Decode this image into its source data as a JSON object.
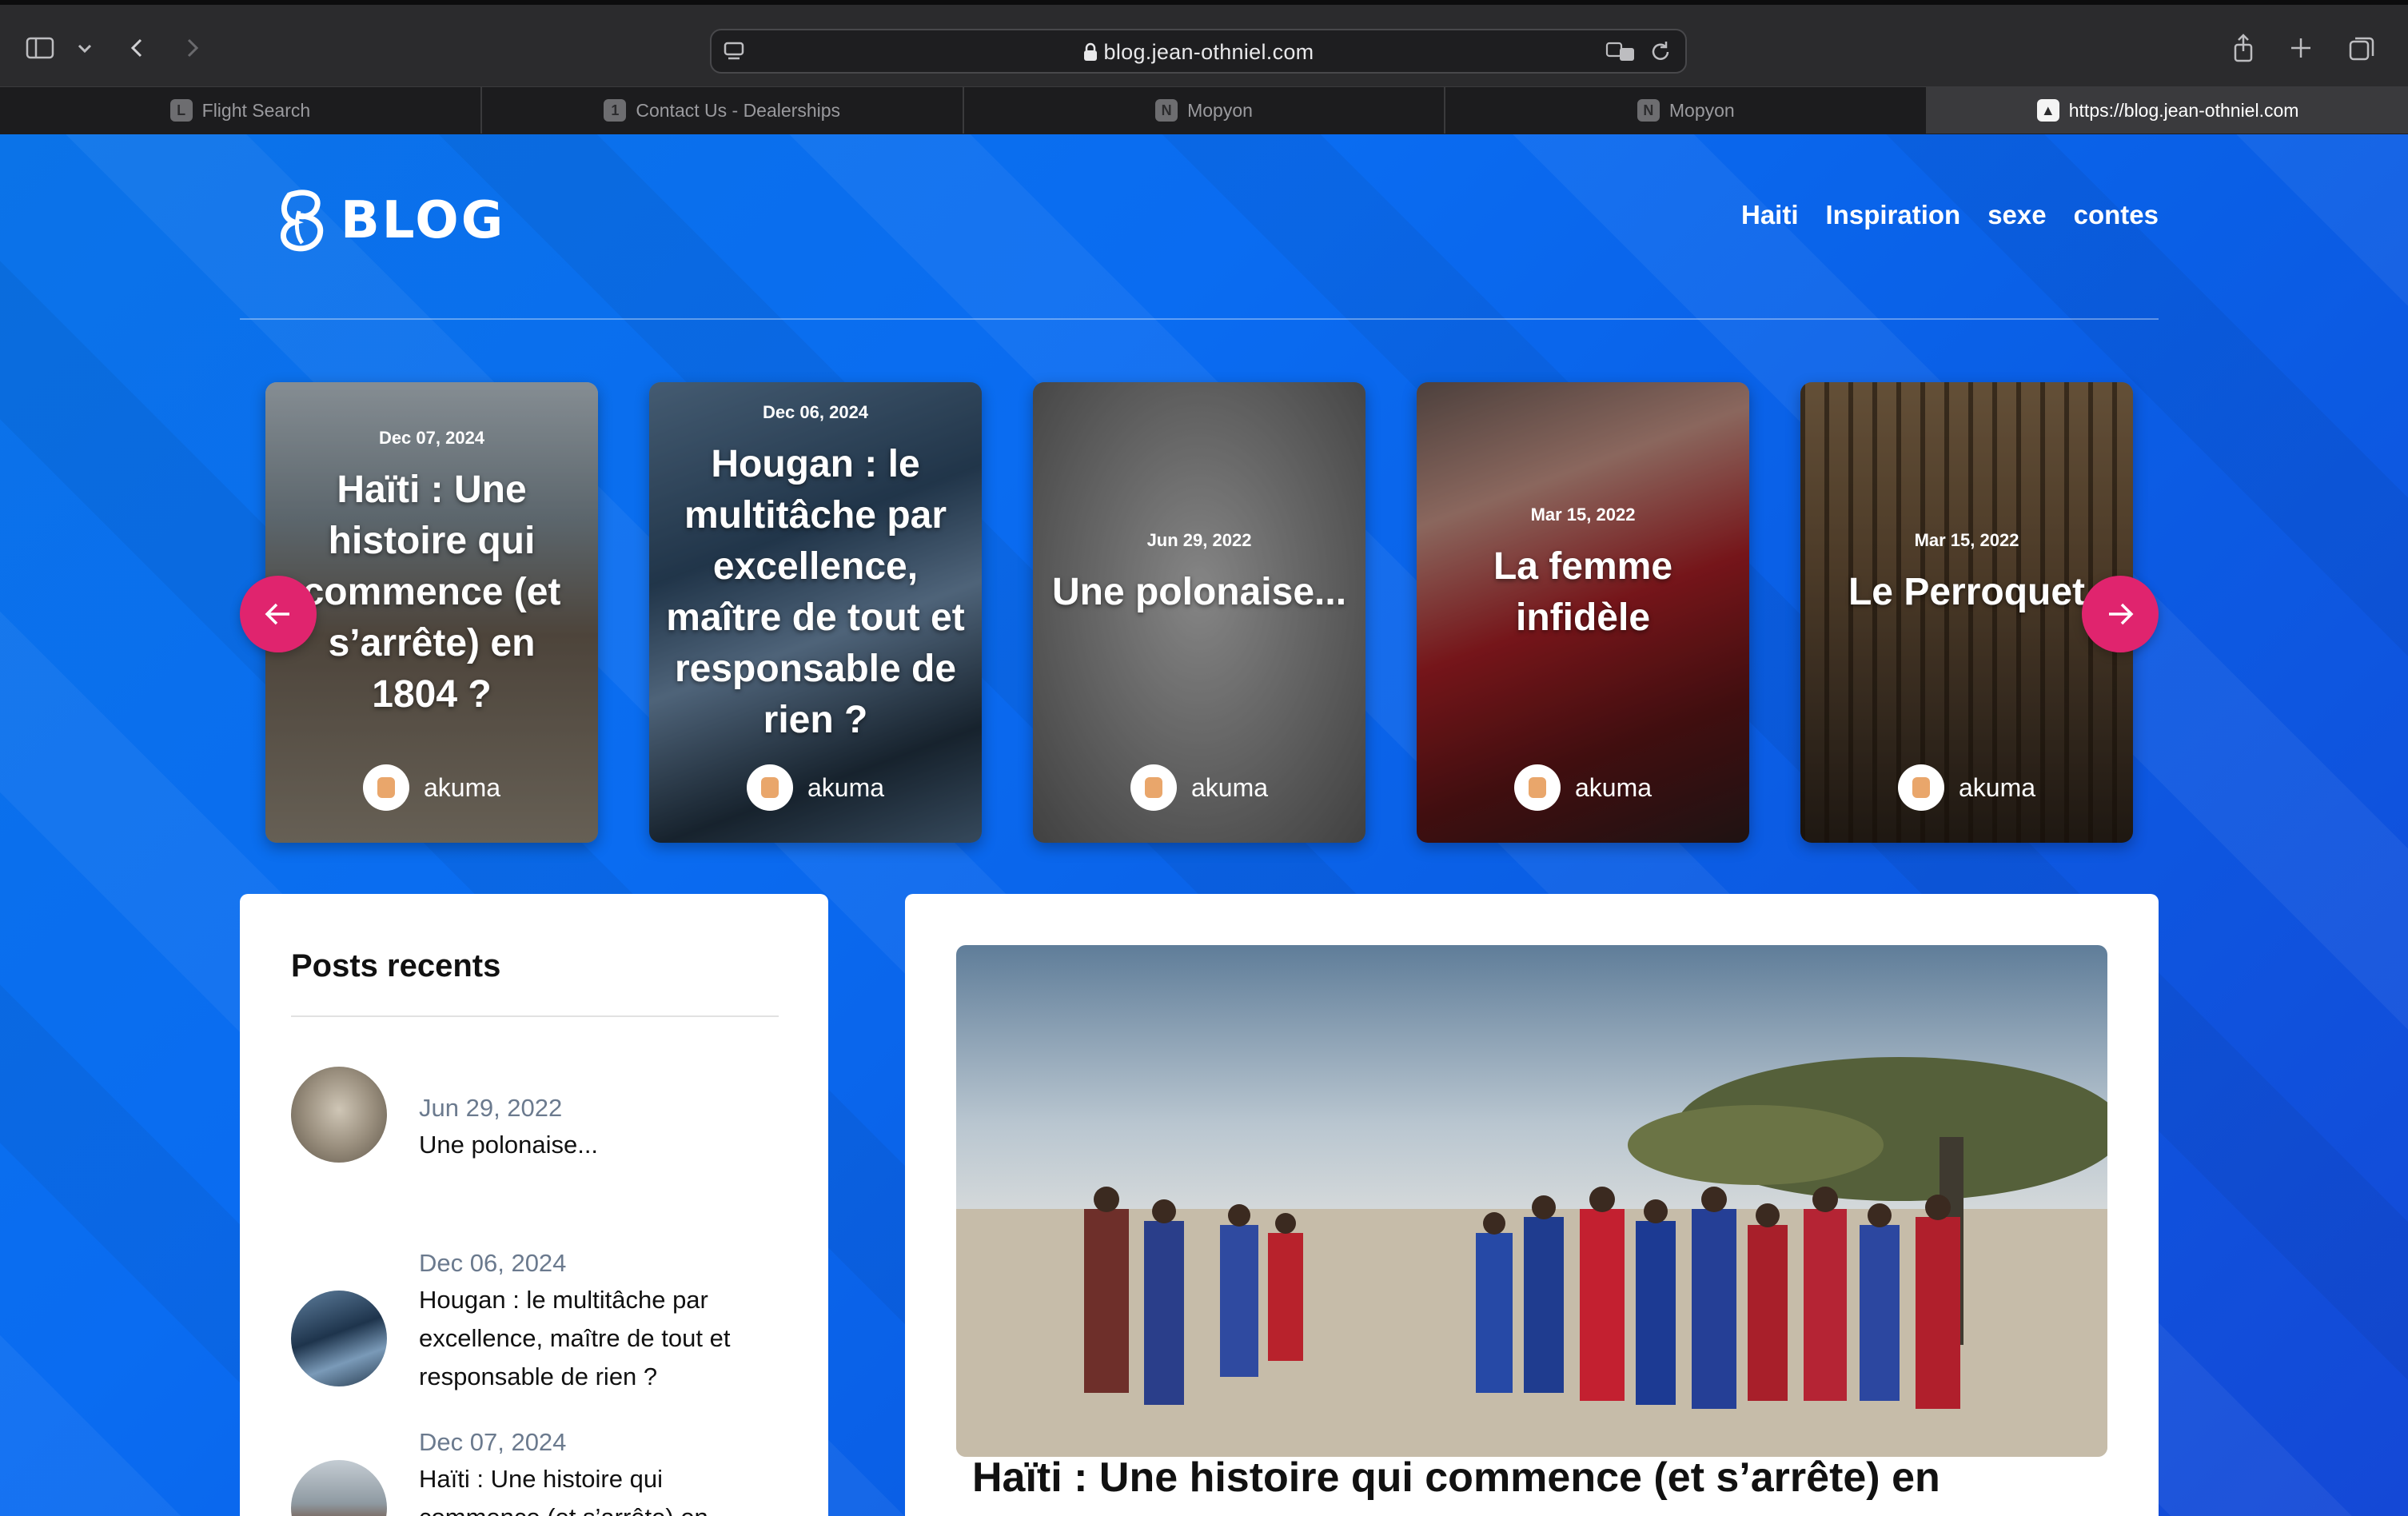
{
  "browser": {
    "url": "blog.jean-othniel.com",
    "tabs": [
      {
        "favicon": "L",
        "label": "Flight Search"
      },
      {
        "favicon": "1",
        "label": "Contact Us - Dealerships"
      },
      {
        "favicon": "N",
        "label": "Mopyon"
      },
      {
        "favicon": "N",
        "label": "Mopyon"
      },
      {
        "favicon": "▲",
        "label": "https://blog.jean-othniel.com"
      }
    ]
  },
  "site": {
    "logo_text": "BLOG",
    "nav": [
      "Haiti",
      "Inspiration",
      "sexe",
      "contes"
    ]
  },
  "slider": {
    "cards": [
      {
        "date": "Dec 07, 2024",
        "title": "Haïti : Une histoire qui commence (et s’arrête) en 1804 ?",
        "author": "akuma"
      },
      {
        "date": "Dec 06, 2024",
        "title": "Hougan : le multitâche par excellence, maître de tout et responsable de rien ?",
        "author": "akuma"
      },
      {
        "date": "Jun 29, 2022",
        "title": "Une polonaise...",
        "author": "akuma"
      },
      {
        "date": "Mar 15, 2022",
        "title": "La femme infidèle",
        "author": "akuma"
      },
      {
        "date": "Mar 15, 2022",
        "title": "Le Perroquet",
        "author": "akuma"
      }
    ]
  },
  "recent": {
    "heading": "Posts recents",
    "items": [
      {
        "date": "Jun 29, 2022",
        "title": "Une polonaise..."
      },
      {
        "date": "Dec 06, 2024",
        "title": "Hougan : le multitâche par excellence, maître de tout et responsable de rien ?"
      },
      {
        "date": "Dec 07, 2024",
        "title": "Haïti : Une histoire qui commence (et s’arrête) en"
      }
    ]
  },
  "article": {
    "title": "Haïti : Une histoire qui commence (et s’arrête) en"
  },
  "colors": {
    "accent": "#e0246e",
    "page_blue": "#0a6cf1"
  }
}
